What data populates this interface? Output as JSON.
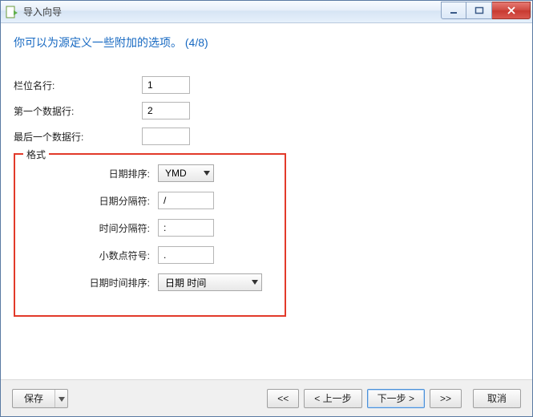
{
  "window": {
    "title": "导入向导"
  },
  "heading": "你可以为源定义一些附加的选项。 (4/8)",
  "fields": {
    "col_name_row": {
      "label": "栏位名行:",
      "value": "1"
    },
    "first_data_row": {
      "label": "第一个数据行:",
      "value": "2"
    },
    "last_data_row": {
      "label": "最后一个数据行:",
      "value": ""
    }
  },
  "format": {
    "legend": "格式",
    "date_order": {
      "label": "日期排序:",
      "value": "YMD"
    },
    "date_sep": {
      "label": "日期分隔符:",
      "value": "/"
    },
    "time_sep": {
      "label": "时间分隔符:",
      "value": ":"
    },
    "decimal_symbol": {
      "label": "小数点符号:",
      "value": "."
    },
    "datetime_order": {
      "label": "日期时间排序:",
      "value": "日期 时间"
    }
  },
  "footer": {
    "save": "保存",
    "first": "<<",
    "prev": "< 上一步",
    "next": "下一步 >",
    "last": ">>",
    "cancel": "取消"
  }
}
